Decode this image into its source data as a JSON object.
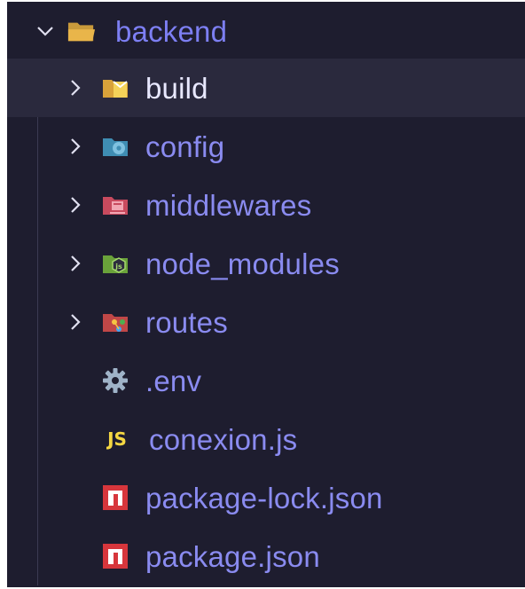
{
  "explorer": {
    "root": {
      "label": "backend",
      "expanded": true,
      "icon": "folder-open-icon"
    },
    "items": [
      {
        "label": "build",
        "type": "folder",
        "expanded": false,
        "selected": true,
        "icon": "folder-build-icon",
        "color": "#e8b83d"
      },
      {
        "label": "config",
        "type": "folder",
        "expanded": false,
        "selected": false,
        "icon": "folder-config-icon",
        "color": "#4a9fc7"
      },
      {
        "label": "middlewares",
        "type": "folder",
        "expanded": false,
        "selected": false,
        "icon": "folder-middleware-icon",
        "color": "#d9566a"
      },
      {
        "label": "node_modules",
        "type": "folder",
        "expanded": false,
        "selected": false,
        "icon": "folder-node-icon",
        "color": "#7cb342"
      },
      {
        "label": "routes",
        "type": "folder",
        "expanded": false,
        "selected": false,
        "icon": "folder-routes-icon",
        "color": "#c94d4d"
      },
      {
        "label": ".env",
        "type": "file",
        "selected": false,
        "icon": "gear-icon",
        "color": "#9fb3c8"
      },
      {
        "label": "conexion.js",
        "type": "file",
        "selected": false,
        "icon": "js-icon",
        "icon_text": "JS",
        "color": "#f5d742"
      },
      {
        "label": "package-lock.json",
        "type": "file",
        "selected": false,
        "icon": "npm-icon",
        "color": "#d7363c"
      },
      {
        "label": "package.json",
        "type": "file",
        "selected": false,
        "icon": "npm-icon",
        "color": "#d7363c"
      }
    ]
  },
  "colors": {
    "background": "#1e1d2f",
    "selected": "#2a293d",
    "label": "#8a8bf0",
    "chevron": "#e0e0f0"
  }
}
